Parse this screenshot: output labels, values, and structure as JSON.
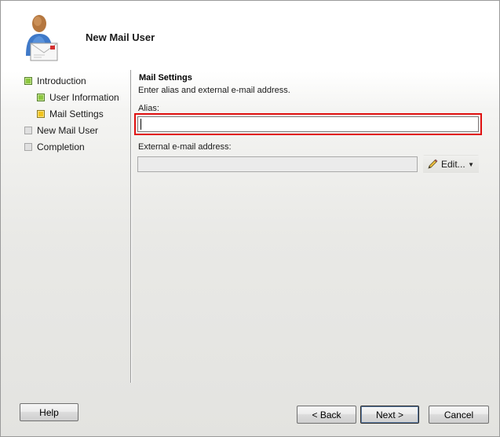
{
  "header": {
    "title": "New Mail User"
  },
  "nav": {
    "items": [
      {
        "label": "Introduction",
        "status": "complete",
        "color": "#8cc63f"
      },
      {
        "label": "User Information",
        "status": "complete",
        "color": "#8cc63f"
      },
      {
        "label": "Mail Settings",
        "status": "current",
        "color": "#f2c31b"
      },
      {
        "label": "New Mail User",
        "status": "pending",
        "color": "#e0e0e0"
      },
      {
        "label": "Completion",
        "status": "pending",
        "color": "#e0e0e0"
      }
    ]
  },
  "main": {
    "section_title": "Mail Settings",
    "description": "Enter alias and external e-mail address.",
    "alias": {
      "label": "Alias:",
      "value": ""
    },
    "external_email": {
      "label": "External e-mail address:",
      "value": ""
    },
    "edit_button": {
      "label": "Edit...",
      "icon": "pencil-icon"
    }
  },
  "footer": {
    "help_label": "Help",
    "back_label": "< Back",
    "next_label": "Next >",
    "cancel_label": "Cancel"
  },
  "colors": {
    "highlight": "#e01010"
  }
}
